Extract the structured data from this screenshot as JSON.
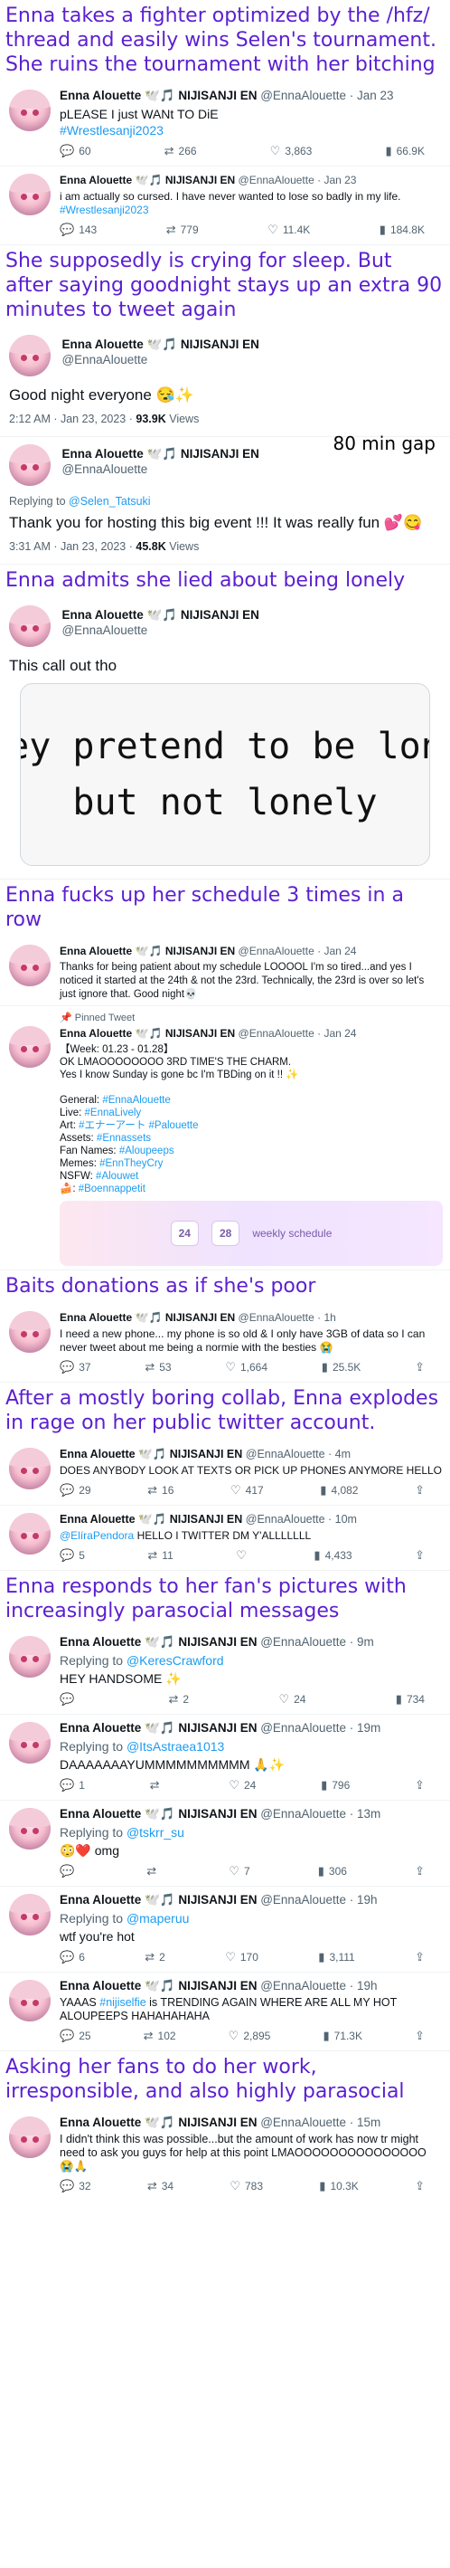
{
  "account": {
    "name": "Enna Alouette",
    "emoji": "🕊️🎵",
    "org": "NIJISANJI EN",
    "handle": "@EnnaAlouette"
  },
  "captions": [
    "Enna takes a fighter optimized by the /hfz/ thread and easily wins Selen's tournament. She ruins the tournament with her bitching",
    "She supposedly is crying for sleep. But after saying goodnight stays up an extra 90 minutes to tweet again",
    "Enna admits she lied about being lonely",
    "Enna fucks up her schedule 3 times in a row",
    "Baits donations as if she's poor",
    "After a mostly boring collab, Enna explodes in rage on her public twitter account.",
    "Enna responds to her fan's pictures with increasingly parasocial messages",
    "Asking her fans to do her work, irresponsible, and also highly parasocial"
  ],
  "t1": {
    "time": "· Jan 23",
    "text": "pLEASE I just WANt TO DiE",
    "tag": "#Wrestlesanji2023",
    "replies": "60",
    "retweets": "266",
    "likes": "3,863",
    "views": "66.9K"
  },
  "t2": {
    "time": "· Jan 23",
    "text": "i am actually so cursed. I have never wanted to lose so badly in my life.",
    "tag": "#Wrestlesanji2023",
    "replies": "143",
    "retweets": "779",
    "likes": "11.4K",
    "views": "184.8K"
  },
  "t3": {
    "text": "Good night everyone 😪✨",
    "time": "2:12 AM · Jan 23, 2023 ·",
    "views_n": "93.9K",
    "views_l": "Views"
  },
  "gap_note": "80 min gap",
  "t4": {
    "reply_to": "Replying to",
    "reply_handle": "@Selen_Tatsuki",
    "text": "Thank you for hosting this big event !!! It was really fun 💕😋",
    "time": "3:31 AM · Jan 23, 2023 ·",
    "views_n": "45.8K",
    "views_l": "Views"
  },
  "t5": {
    "text": "This call out tho",
    "img_line1": "'hey pretend to be lonel",
    "img_line2": "but not lonely"
  },
  "t6": {
    "time": "· Jan 24",
    "text": "Thanks for being patient about my schedule LOOOOL I'm so tired...and yes I noticed it started at the 24th & not the 23rd. Technically, the 23rd is over so let's just ignore that. Good night💀"
  },
  "t7": {
    "pinned": "Pinned Tweet",
    "time": "· Jan 24",
    "l1": "【Week: 01.23 - 01.28】",
    "l2": "OK LMAOOOOOOOO 3RD TIME'S THE CHARM.",
    "l3": "Yes I know Sunday is gone bc I'm TBDing on it !! ✨",
    "g": "General:",
    "g_t": "#EnnaAlouette",
    "li": "Live:",
    "li_t": "#EnnaLively",
    "ar": "Art:",
    "ar_t": "#エナーアート #Palouette",
    "as": "Assets:",
    "as_t": "#Ennassets",
    "fn": "Fan Names:",
    "fn_t": "#Aloupeeps",
    "me": "Memes:",
    "me_t": "#EnnTheyCry",
    "ns": "NSFW:",
    "ns_t": "#Alouwet",
    "fo": "🍰:",
    "fo_t": "#Boennappetit",
    "d1": "24",
    "d2": "28",
    "bn": "weekly schedule"
  },
  "t8": {
    "time": "· 1h",
    "text": "I need a new phone... my phone is so old & I only have 3GB of data so I can never tweet about me being a normie with the besties 😭",
    "replies": "37",
    "retweets": "53",
    "likes": "1,664",
    "views": "25.5K"
  },
  "t9": {
    "time": "· 4m",
    "text": "DOES ANYBODY LOOK AT TEXTS OR PICK UP PHONES ANYMORE HELLO",
    "replies": "29",
    "retweets": "16",
    "likes": "417",
    "views": "4,082"
  },
  "t10": {
    "time": "· 10m",
    "mention": "@ElíraPendora",
    "text": "HELLO I TWITTER DM Y'ALLLLLLL",
    "replies": "5",
    "retweets": "11",
    "likes": "",
    "views": "4,433"
  },
  "t11": {
    "time": "· 9m",
    "reply_to": "Replying to",
    "reply_handle": "@KeresCrawford",
    "text": "HEY HANDSOME ✨",
    "replies": "",
    "retweets": "2",
    "likes": "24",
    "views": "734"
  },
  "t12": {
    "time": "· 19m",
    "reply_to": "Replying to",
    "reply_handle": "@ItsAstraea1013",
    "text": "DAAAAAAAYUMMMMMMMMMM 🙏✨",
    "replies": "1",
    "retweets": "",
    "likes": "24",
    "views": "796"
  },
  "t13": {
    "time": "· 13m",
    "reply_to": "Replying to",
    "reply_handle": "@tskrr_su",
    "text": "😳❤️ omg",
    "replies": "",
    "retweets": "",
    "likes": "7",
    "views": "306"
  },
  "t14": {
    "time": "· 19h",
    "reply_to": "Replying to",
    "reply_handle": "@maperuu",
    "text": "wtf you're hot",
    "replies": "6",
    "retweets": "2",
    "likes": "170",
    "views": "3,111"
  },
  "t15": {
    "time": "· 19h",
    "pre": "YAAAS",
    "tag": "#nijiselfie",
    "text": "is TRENDING AGAIN WHERE ARE ALL MY HOT ALOUPEEPS HAHAHAHAHA",
    "replies": "25",
    "retweets": "102",
    "likes": "2,895",
    "views": "71.3K"
  },
  "t16": {
    "time": "· 15m",
    "text": "I didn't think this was possible...but the amount of work has now tr might need to ask you guys for help at this point LMAOOOOOOOOOOOOOOO 😭🙏",
    "replies": "32",
    "retweets": "34",
    "likes": "783",
    "views": "10.3K"
  }
}
